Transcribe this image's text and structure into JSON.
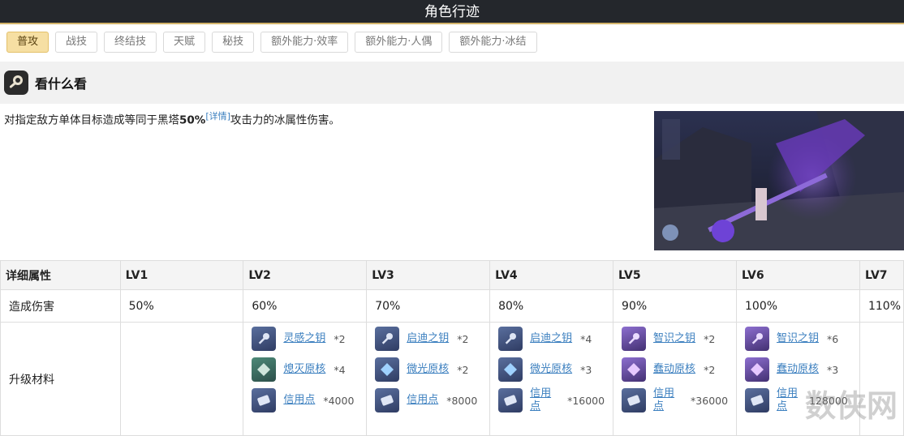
{
  "header": {
    "title": "角色行迹"
  },
  "tabs": [
    {
      "label": "普攻",
      "active": true
    },
    {
      "label": "战技"
    },
    {
      "label": "终结技"
    },
    {
      "label": "天赋"
    },
    {
      "label": "秘技"
    },
    {
      "label": "额外能力·效率"
    },
    {
      "label": "额外能力·人偶"
    },
    {
      "label": "额外能力·冰结"
    }
  ],
  "skill": {
    "name": "看什么看",
    "desc_pre": "对指定敌方单体目标造成等同于黑塔",
    "desc_pct": "50%",
    "desc_link": "[详情]",
    "desc_post": "攻击力的冰属性伤害。"
  },
  "table": {
    "headers": [
      "详细属性",
      "LV1",
      "LV2",
      "LV3",
      "LV4",
      "LV5",
      "LV6",
      "LV7"
    ],
    "damage_label": "造成伤害",
    "damage": [
      "50%",
      "60%",
      "70%",
      "80%",
      "90%",
      "100%",
      "110%"
    ],
    "materials_label": "升级材料",
    "materials": {
      "lv2": [
        {
          "name": "灵感之钥",
          "qty": "*2"
        },
        {
          "name": "熄灭原核",
          "qty": "*4"
        },
        {
          "name": "信用点",
          "qty": "*4000"
        }
      ],
      "lv3": [
        {
          "name": "启迪之钥",
          "qty": "*2"
        },
        {
          "name": "微光原核",
          "qty": "*2"
        },
        {
          "name": "信用点",
          "qty": "*8000"
        }
      ],
      "lv4": [
        {
          "name": "启迪之钥",
          "qty": "*4"
        },
        {
          "name": "微光原核",
          "qty": "*3"
        },
        {
          "name": "信用点",
          "qty": "*16000"
        }
      ],
      "lv5": [
        {
          "name": "智识之钥",
          "qty": "*2"
        },
        {
          "name": "蠢动原核",
          "qty": "*2"
        },
        {
          "name": "信用点",
          "qty": "*36000"
        }
      ],
      "lv6": [
        {
          "name": "智识之钥",
          "qty": "*6"
        },
        {
          "name": "蠢动原核",
          "qty": "*3"
        },
        {
          "name": "信用点",
          "qty": "128000"
        }
      ]
    }
  },
  "watermark": "数侠网",
  "colors": {
    "tab_active_bg": "#f6dfa3",
    "link": "#3b7fbf",
    "header_bg": "#24272c"
  }
}
